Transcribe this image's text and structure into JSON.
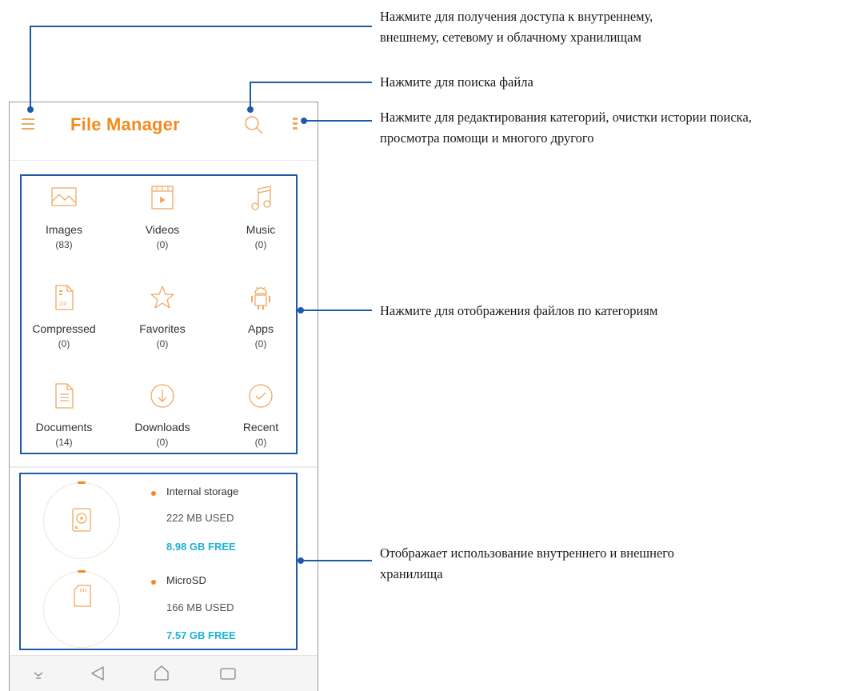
{
  "callouts": {
    "storage_access": [
      "Нажмите для получения доступа к внутреннему,",
      "внешнему, сетевому и облачному хранилищам"
    ],
    "search": "Нажмите для поиска файла",
    "menu": [
      "Нажмите для редактирования категорий, очистки истории поиска,",
      "просмотра помощи и многого другого"
    ],
    "categories": "Нажмите для отображения файлов по категориям",
    "storage_usage": [
      "Отображает использование внутреннего и внешнего",
      "хранилища"
    ]
  },
  "app": {
    "title": "File Manager",
    "accent_color": "#f08c1e",
    "free_color": "#1fb4d2",
    "annotation_color": "#1e5aa8"
  },
  "categories": [
    {
      "label": "Images",
      "count": "(83)",
      "icon": "image-icon"
    },
    {
      "label": "Videos",
      "count": "(0)",
      "icon": "video-icon"
    },
    {
      "label": "Music",
      "count": "(0)",
      "icon": "music-icon"
    },
    {
      "label": "Compressed",
      "count": "(0)",
      "icon": "zip-icon"
    },
    {
      "label": "Favorites",
      "count": "(0)",
      "icon": "star-icon"
    },
    {
      "label": "Apps",
      "count": "(0)",
      "icon": "android-icon"
    },
    {
      "label": "Documents",
      "count": "(14)",
      "icon": "document-icon"
    },
    {
      "label": "Downloads",
      "count": "(0)",
      "icon": "download-icon"
    },
    {
      "label": "Recent",
      "count": "(0)",
      "icon": "recent-icon"
    }
  ],
  "storage": [
    {
      "name": "Internal storage",
      "used": "222 MB USED",
      "free": "8.98 GB FREE",
      "icon": "hard-drive-icon"
    },
    {
      "name": "MicroSD",
      "used": "166 MB USED",
      "free": "7.57 GB FREE",
      "icon": "sd-card-icon"
    }
  ],
  "navbar": [
    "collapse-icon",
    "back-icon",
    "home-icon",
    "recents-icon"
  ]
}
